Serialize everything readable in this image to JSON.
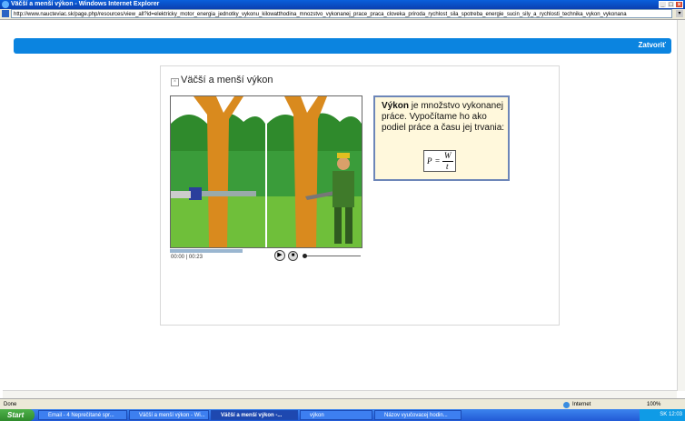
{
  "window": {
    "title": "Väčší a menší výkon - Windows Internet Explorer",
    "url": "http://www.naucteviac.sk/page.php/resources/view_all?id=elektricky_motor_energia_jednotky_vykonu_kilowatthodina_mnozstvo_vykonanej_prace_praca_cloveka_priroda_rychlost_sila_spotreba_energie_sucin_sily_a_rychlosti_technika_vykon_vykonana"
  },
  "header": {
    "close_label": "Zatvoriť"
  },
  "lesson": {
    "title": "Väčší a menší výkon",
    "info_bold": "Výkon",
    "info_rest": " je množstvo vykonanej práce. Vypočítame ho ako podiel práce a času jej trvania:",
    "formula": {
      "lhs": "P",
      "eq": "=",
      "num": "W",
      "den": "t"
    }
  },
  "player": {
    "time_current": "00:00",
    "time_sep": "|",
    "time_total": "00:23",
    "progress": 0.02
  },
  "statusbar": {
    "status": "Done",
    "zone": "Internet",
    "zoom": "100%"
  },
  "taskbar": {
    "start_label": "Start",
    "tasks": [
      "Email - 4 Neprečítané spr...",
      "Väčší a menší výkon - Wi...",
      "Väčší a menší výkon -...",
      "výkon",
      "Názov vyučovacej hodin..."
    ],
    "lang": "SK",
    "clock": "12:03"
  }
}
